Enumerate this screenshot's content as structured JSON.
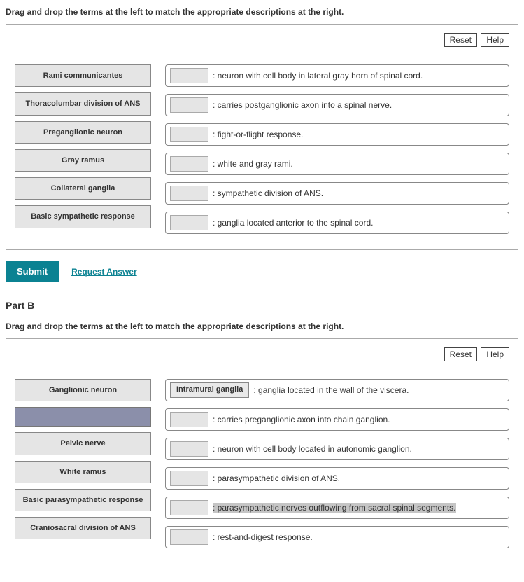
{
  "partA": {
    "instructions": "Drag and drop the terms at the left to match the appropriate descriptions at the right.",
    "reset": "Reset",
    "help": "Help",
    "terms": [
      "Rami communicantes",
      "Thoracolumbar division of ANS",
      "Preganglionic neuron",
      "Gray ramus",
      "Collateral ganglia",
      "Basic sympathetic response"
    ],
    "drops": [
      {
        "filled": "",
        "desc": ": neuron with cell body in lateral gray horn of spinal cord."
      },
      {
        "filled": "",
        "desc": ": carries postganglionic axon into a spinal nerve."
      },
      {
        "filled": "",
        "desc": ": fight-or-flight response."
      },
      {
        "filled": "",
        "desc": ": white and gray rami."
      },
      {
        "filled": "",
        "desc": ": sympathetic division of ANS."
      },
      {
        "filled": "",
        "desc": ": ganglia located anterior to the spinal cord."
      }
    ],
    "submit": "Submit",
    "request": "Request Answer"
  },
  "partB": {
    "heading": "Part B",
    "instructions": "Drag and drop the terms at the left to match the appropriate descriptions at the right.",
    "reset": "Reset",
    "help": "Help",
    "terms": [
      {
        "label": "Ganglionic neuron",
        "empty": false
      },
      {
        "label": "",
        "empty": true
      },
      {
        "label": "Pelvic nerve",
        "empty": false
      },
      {
        "label": "White ramus",
        "empty": false
      },
      {
        "label": "Basic parasympathetic response",
        "empty": false
      },
      {
        "label": "Craniosacral division of ANS",
        "empty": false
      }
    ],
    "drops": [
      {
        "filled": "Intramural ganglia",
        "desc": ": ganglia located in the wall of the viscera.",
        "hl": false
      },
      {
        "filled": "",
        "desc": ": carries preganglionic axon into chain ganglion.",
        "hl": false
      },
      {
        "filled": "",
        "desc": ": neuron with cell body located in autonomic ganglion.",
        "hl": false
      },
      {
        "filled": "",
        "desc": ": parasympathetic division of ANS.",
        "hl": false
      },
      {
        "filled": "",
        "desc": ": parasympathetic nerves outflowing from sacral spinal segments.",
        "hl": true
      },
      {
        "filled": "",
        "desc": ": rest-and-digest response.",
        "hl": false
      }
    ]
  }
}
